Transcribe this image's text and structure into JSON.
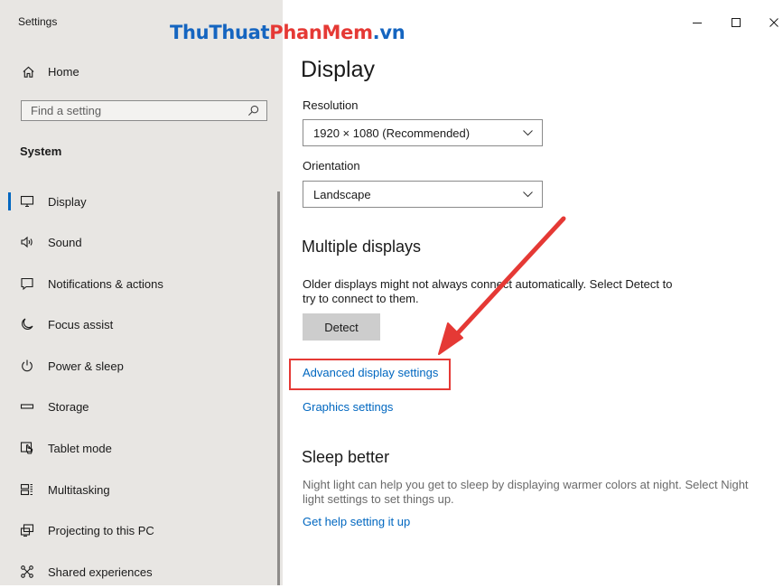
{
  "window": {
    "title": "Settings"
  },
  "watermark": {
    "part_a": "ThuThuat",
    "part_b": "PhanMem",
    "part_c": ".vn"
  },
  "sidebar": {
    "home_label": "Home",
    "search_placeholder": "Find a setting",
    "section_label": "System",
    "active_item": "Display",
    "items": [
      {
        "label": "Display",
        "icon": "monitor-icon"
      },
      {
        "label": "Sound",
        "icon": "speaker-icon"
      },
      {
        "label": "Notifications & actions",
        "icon": "notification-icon"
      },
      {
        "label": "Focus assist",
        "icon": "moon-icon"
      },
      {
        "label": "Power & sleep",
        "icon": "power-icon"
      },
      {
        "label": "Storage",
        "icon": "storage-icon"
      },
      {
        "label": "Tablet mode",
        "icon": "tablet-mode-icon"
      },
      {
        "label": "Multitasking",
        "icon": "multitasking-icon"
      },
      {
        "label": "Projecting to this PC",
        "icon": "projecting-icon"
      },
      {
        "label": "Shared experiences",
        "icon": "shared-experiences-icon"
      }
    ]
  },
  "main": {
    "title": "Display",
    "resolution": {
      "label": "Resolution",
      "value": "1920 × 1080 (Recommended)"
    },
    "orientation": {
      "label": "Orientation",
      "value": "Landscape"
    },
    "multiple_displays": {
      "heading": "Multiple displays",
      "text_line1": "Older displays might not always connect automatically. Select Detect to",
      "text_line2": "try to connect to them.",
      "detect_button": "Detect",
      "advanced_link": "Advanced display settings",
      "graphics_link": "Graphics settings"
    },
    "sleep_better": {
      "heading": "Sleep better",
      "text_line1": "Night light can help you get to sleep by displaying warmer colors at night. Select Night",
      "text_line2": "light settings to set things up.",
      "help_link": "Get help setting it up"
    }
  },
  "colors": {
    "accent": "#0067c0",
    "annotation": "#e53935",
    "sidebar_bg": "#e8e6e3"
  }
}
